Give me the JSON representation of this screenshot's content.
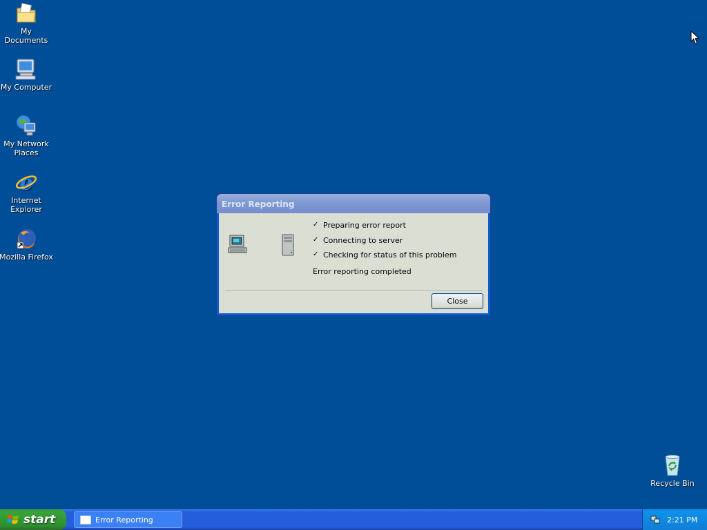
{
  "desktop": {
    "icons": [
      {
        "label": "My Documents"
      },
      {
        "label": "My Computer"
      },
      {
        "label": "My Network Places"
      },
      {
        "label": "Internet Explorer"
      },
      {
        "label": "Mozilla Firefox"
      }
    ],
    "recycle_bin": {
      "label": "Recycle Bin"
    }
  },
  "dialog": {
    "title": "Error Reporting",
    "steps": [
      {
        "check": "✓",
        "label": "Preparing error report"
      },
      {
        "check": "✓",
        "label": "Connecting to server"
      },
      {
        "check": "✓",
        "label": "Checking for status of this problem"
      }
    ],
    "status": "Error reporting completed",
    "close_label": "Close"
  },
  "taskbar": {
    "start_label": "start",
    "tasks": [
      {
        "label": "Error Reporting"
      }
    ],
    "clock": "2:21 PM"
  },
  "colors": {
    "desktop": "#004e98",
    "taskbar": "#245edb",
    "start": "#37a337",
    "dialog_face": "#ece9d8"
  }
}
